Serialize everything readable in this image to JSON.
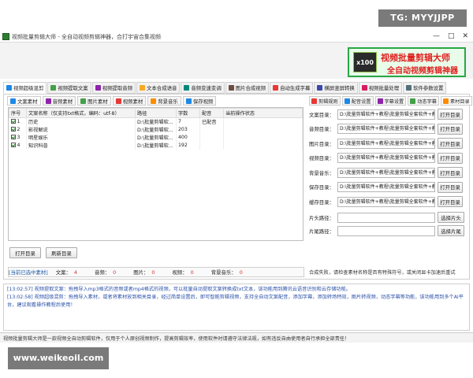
{
  "watermark_top": "TG: MYYJJPP",
  "watermark_bottom": "www.weikeoil.com",
  "window": {
    "title": "视频批量剪辑大师 - 全自动视频剪辑神器，合打宇宙合集视频",
    "controls": [
      "—",
      "□",
      "✕"
    ]
  },
  "banner": {
    "badge": "x100",
    "line1": "视频批量剪辑大师",
    "line2": "全自动视频剪辑神器"
  },
  "main_tabs": [
    {
      "label": "视频超级混剪",
      "icon": "video-icon",
      "color": "#1e88e5",
      "active": true
    },
    {
      "label": "视频提取文案",
      "icon": "document-icon",
      "color": "#43a047"
    },
    {
      "label": "视频提取音频",
      "icon": "music-icon",
      "color": "#8e24aa"
    },
    {
      "label": "文本合成语音",
      "icon": "speaker-icon",
      "color": "#f9a825"
    },
    {
      "label": "音频变速变调",
      "icon": "sound-wave-icon",
      "color": "#00897b"
    },
    {
      "label": "图片合成视频",
      "icon": "image-icon",
      "color": "#6d4c41"
    },
    {
      "label": "自动生成字幕",
      "icon": "subtitle-icon",
      "color": "#e53935"
    },
    {
      "label": "横屏竖屏转换",
      "icon": "rotate-icon",
      "color": "#3949ab"
    },
    {
      "label": "视频批量处理",
      "icon": "batch-icon",
      "color": "#d81b60"
    },
    {
      "label": "软件参数设置",
      "icon": "gear-icon",
      "color": "#546e7a"
    }
  ],
  "sub_tabs": [
    {
      "label": "文案素材",
      "icon": "text-icon",
      "color": "#1e88e5",
      "active": true
    },
    {
      "label": "音频素材",
      "icon": "music-icon",
      "color": "#8e24aa"
    },
    {
      "label": "图片素材",
      "icon": "image-icon",
      "color": "#43a047"
    },
    {
      "label": "视频素材",
      "icon": "video-icon",
      "color": "#e53935"
    },
    {
      "label": "背景音乐",
      "icon": "music-note-icon",
      "color": "#fb8c00"
    },
    {
      "label": "保存视频",
      "icon": "play-icon",
      "color": "#1e88e5"
    }
  ],
  "grid": {
    "columns": [
      "序号",
      "文案名称（仅支持txt格式，编码：utf-8）",
      "路径",
      "字数",
      "配音",
      "当前操作状态"
    ],
    "rows": [
      {
        "no": "1",
        "name": "历史",
        "path": "D:\\批量剪辑软...",
        "count": "7",
        "dub": "已配音",
        "status": ""
      },
      {
        "no": "2",
        "name": "影视解说",
        "path": "D:\\批量剪辑软...",
        "count": "203",
        "dub": "",
        "status": ""
      },
      {
        "no": "3",
        "name": "明星娱乐",
        "path": "D:\\批量剪辑软...",
        "count": "400",
        "dub": "",
        "status": ""
      },
      {
        "no": "4",
        "name": "知识科普",
        "path": "D:\\批量剪辑软...",
        "count": "192",
        "dub": "",
        "status": ""
      }
    ]
  },
  "buttons": {
    "open_dir": "打开目录",
    "refresh_dir": "刷新目录",
    "open": "打开目录",
    "select_clip": "选择片头",
    "select_end": "选择片尾"
  },
  "status_bar": {
    "label": "[当前已选中素材]",
    "items": [
      {
        "label": "文案：",
        "value": "4"
      },
      {
        "label": "音频：",
        "value": "0"
      },
      {
        "label": "图片：",
        "value": "0"
      },
      {
        "label": "视频：",
        "value": "0"
      },
      {
        "label": "背景音乐：",
        "value": "0"
      }
    ]
  },
  "right_tabs": [
    {
      "label": "剪辑规则",
      "icon": "scissors-icon",
      "color": "#e53935"
    },
    {
      "label": "配音设置",
      "icon": "mic-icon",
      "color": "#1e88e5"
    },
    {
      "label": "字幕设置",
      "icon": "font-icon",
      "color": "#8e24aa"
    },
    {
      "label": "动态字幕",
      "icon": "subtitle-icon",
      "color": "#43a047"
    },
    {
      "label": "素材目录",
      "icon": "folder-icon",
      "color": "#fb8c00",
      "active": true
    }
  ],
  "dir_fields": [
    {
      "label": "文案目录：",
      "value": "D:\\批量剪辑软件+教程\\批量剪辑全套软件+教"
    },
    {
      "label": "音频目录：",
      "value": "D:\\批量剪辑软件+教程\\批量剪辑全套软件+教"
    },
    {
      "label": "图片目录：",
      "value": "D:\\批量剪辑软件+教程\\批量剪辑全套软件+教"
    },
    {
      "label": "视频目录：",
      "value": "D:\\批量剪辑软件+教程\\批量剪辑全套软件+教"
    },
    {
      "label": "背景音乐：",
      "value": "D:\\批量剪辑软件+教程\\批量剪辑全套软件+教"
    },
    {
      "label": "保存目录：",
      "value": "D:\\批量剪辑软件+教程\\批量剪辑全套软件+教"
    },
    {
      "label": "缓存目录：",
      "value": "D:\\批量剪辑软件+教程\\批量剪辑全套软件+教"
    }
  ],
  "clip_fields": [
    {
      "label": "片头路径：",
      "value": ""
    },
    {
      "label": "片尾路径：",
      "value": ""
    }
  ],
  "right_note": "合成失败，请检查素材名称是否有特殊符号，或关闭显卡加速后重试",
  "log": [
    "[13:02:57] 视频提取文案：拖拽导入mp3格式的音频或者mp4格式的视频，可以批量自动提取文案转换成txt文本，该功能用到腾讯云语音识别和云存储功能。",
    "[13:02:58] 视频超级混剪：拖拽导入素材，或者将素材放到相关目录，经过简单设置后，即可智能剪辑视频，支持全自动文案配音，添加字幕，添加转场特效，图片转视频，动态字幕等功能，该功能用到多个AI平台，建议观看操作教程后使用！"
  ],
  "bottom_status": "视频批量剪辑大师是一款视频全自动剪辑软件，仅用于个人原创视频制作，提高剪辑效率，使用软件时请遵守法律法规，如有违反自由使用者自行承担全部责任！"
}
